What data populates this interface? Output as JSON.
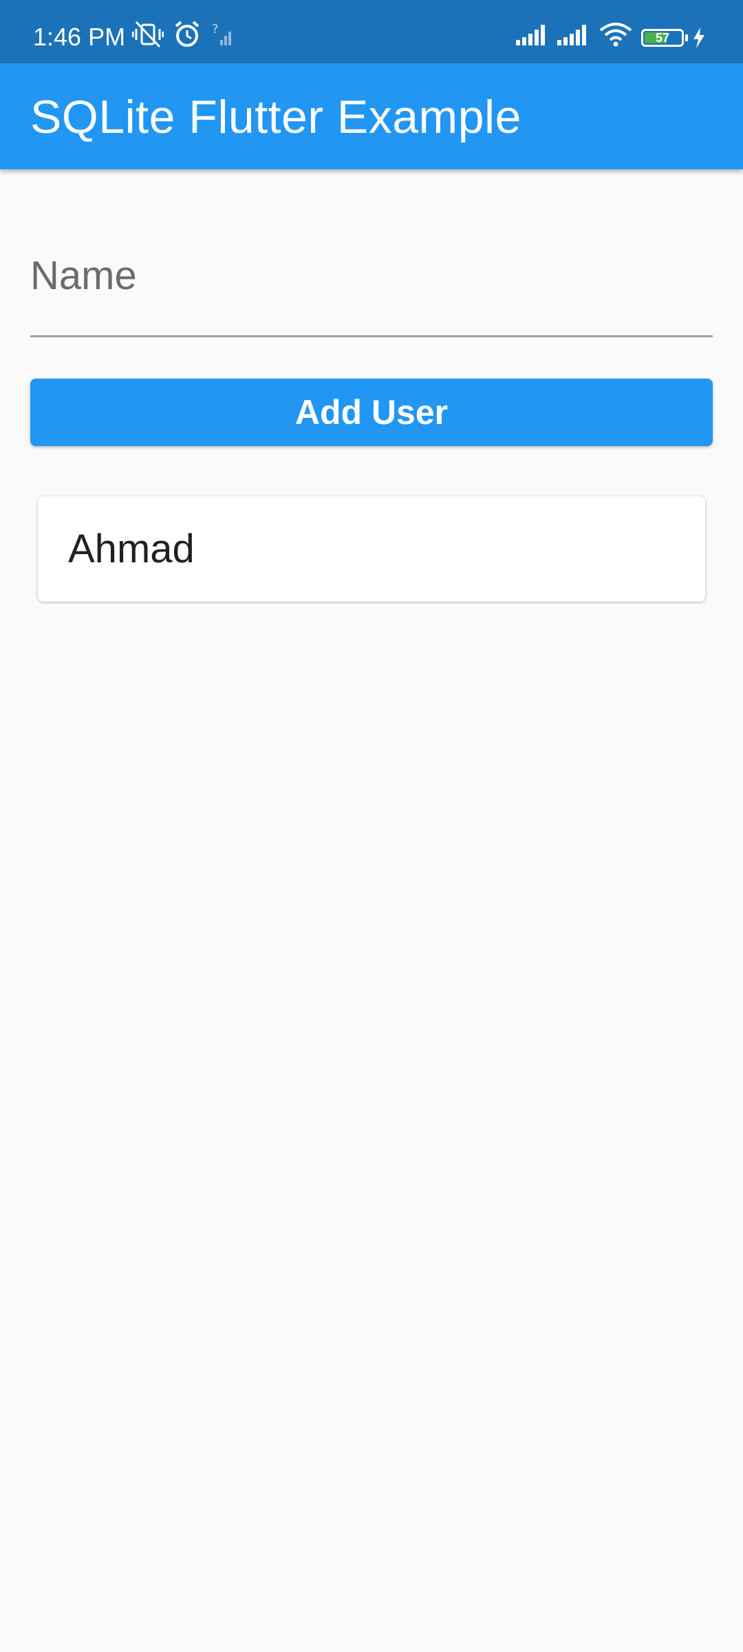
{
  "status_bar": {
    "time": "1:46 PM",
    "battery_level": "57",
    "icons": [
      "vibrate-off-icon",
      "alarm-icon",
      "no-sim-signal-icon",
      "signal-icon",
      "signal-icon",
      "wifi-icon",
      "battery-icon",
      "charging-icon"
    ]
  },
  "app_bar": {
    "title": "SQLite Flutter Example"
  },
  "form": {
    "name_placeholder": "Name",
    "name_value": "",
    "add_button_label": "Add User"
  },
  "users": [
    {
      "name": "Ahmad"
    }
  ],
  "colors": {
    "status_bar": "#1c72b8",
    "primary": "#2196f3",
    "background": "#fafafa"
  }
}
